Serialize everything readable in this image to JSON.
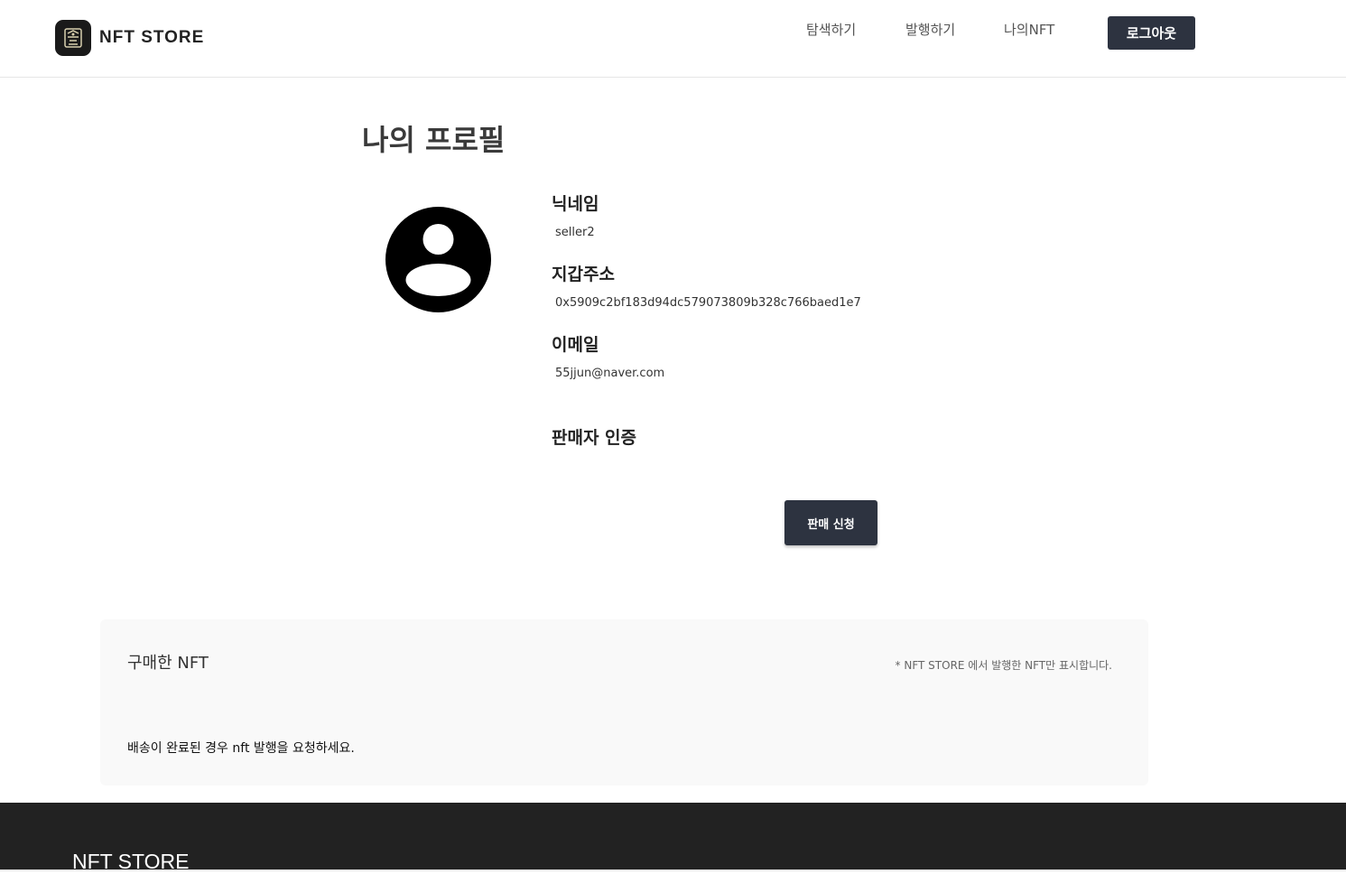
{
  "header": {
    "brand": "NFT STORE",
    "nav": [
      "탐색하기",
      "발행하기",
      "나의NFT"
    ],
    "logout_label": "로그아웃"
  },
  "profile": {
    "title": "나의 프로필",
    "nickname_label": "닉네임",
    "nickname": "seller2",
    "wallet_label": "지갑주소",
    "wallet": "0x5909c2bf183d94dc579073809b328c766baed1e7",
    "email_label": "이메일",
    "email": "55jjun@naver.com",
    "seller_label": "판매자 인증",
    "sale_button": "판매 신청"
  },
  "purchased": {
    "title": "구매한 NFT",
    "note": "* NFT STORE 에서 발행한 NFT만 표시합니다.",
    "message": "배송이 완료된 경우 nft 발행을 요청하세요."
  },
  "footer": {
    "brand": "NFT STORE"
  }
}
